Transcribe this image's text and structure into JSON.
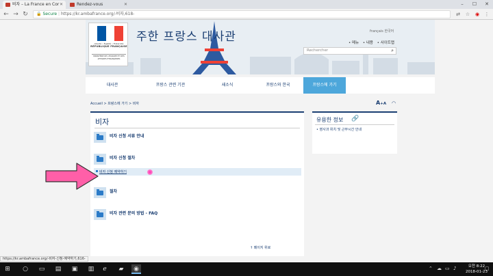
{
  "browser": {
    "tabs": [
      {
        "label": "비자 – La France en Cor",
        "active": true
      },
      {
        "label": "Rendez-vous",
        "active": false
      }
    ],
    "address": {
      "secure_label": "Secure",
      "url": "https://kr.ambafrance.org/-비자,618-"
    },
    "status_url": "https://kr.ambafrance.org/-비자-신청-예약하기,616-"
  },
  "header": {
    "logo": {
      "motto": "Liberté • Égalité • Fraternité",
      "republic": "RÉPUBLIQUE FRANÇAISE",
      "ministry": "MINISTÈRE DE L'EUROPE ET DES AFFAIRES ÉTRANGÈRES"
    },
    "title": "주한 프랑스 대사관",
    "languages": "français 한국어",
    "links": [
      "• 메뉴",
      "• 내용",
      "• 사이트맵"
    ],
    "search_placeholder": "Rechercher"
  },
  "nav": {
    "items": [
      "대사관",
      "프랑스 관련 기관",
      "새소식",
      "프랑스와 한국",
      "프랑스에 가기"
    ],
    "active_index": 4
  },
  "breadcrumb": "Accueil > 프랑스에 가기 > 비자",
  "font_size_control": {
    "big": "A",
    "plus": "+",
    "small": "A"
  },
  "main": {
    "title": "비자",
    "items": [
      "비자 신청 서류 안내",
      "비자 신청 절차",
      "절차",
      "비자 관련 문의 방법 - FAQ"
    ],
    "sub_item": "비자 신청 예약하기",
    "to_top": "↑ 페이지 위로"
  },
  "sidebar": {
    "title": "유용한 정보",
    "items": [
      "• 영사과 위치 및 근무시간 안내"
    ]
  },
  "taskbar": {
    "clock_time": "오전 8:22",
    "clock_date": "2018-01-23"
  },
  "colors": {
    "navy": "#1a3e72",
    "nav_active": "#4da7db",
    "arrow": "#ff5fa8",
    "flag_blue": "#0055a4",
    "flag_red": "#ef4135"
  }
}
